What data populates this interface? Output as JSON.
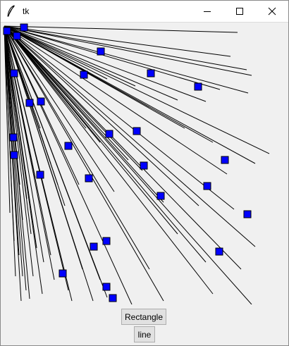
{
  "window": {
    "title": "tk",
    "controls": [
      "minimize-icon",
      "maximize-icon",
      "close-icon"
    ]
  },
  "canvas": {
    "line_color": "#000000",
    "rect_fill": "#0000ff",
    "rect_outline": "#000000"
  },
  "buttons": {
    "rectangle_label": "Rectangle",
    "line_label": "line"
  }
}
